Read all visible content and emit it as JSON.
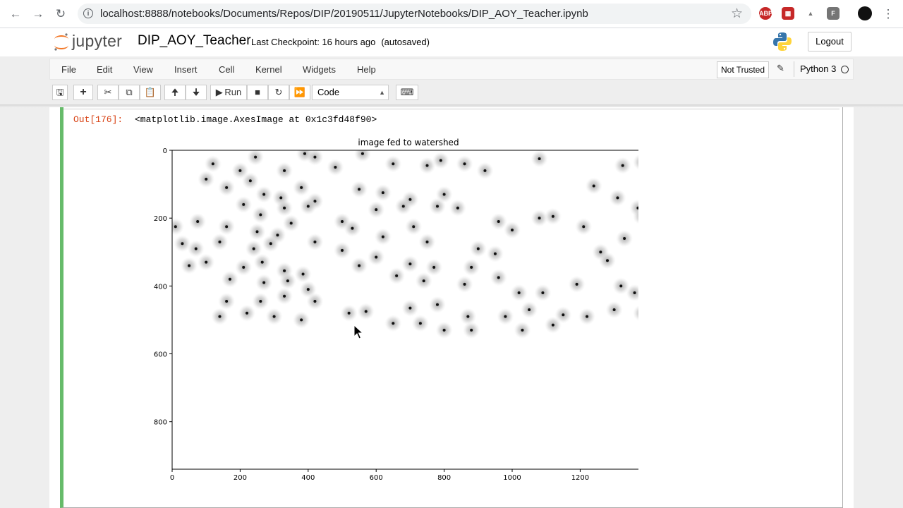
{
  "browser": {
    "url": "localhost:8888/notebooks/Documents/Repos/DIP/20190511/JupyterNotebooks/DIP_AOY_Teacher.ipynb",
    "extensions": [
      "ABP",
      "F"
    ]
  },
  "header": {
    "logo_text": "jupyter",
    "notebook_name": "DIP_AOY_Teacher",
    "checkpoint": "Last Checkpoint: 16 hours ago",
    "autosave": "(autosaved)",
    "logout_label": "Logout"
  },
  "menu": {
    "items": [
      "File",
      "Edit",
      "View",
      "Insert",
      "Cell",
      "Kernel",
      "Widgets",
      "Help"
    ],
    "trust": "Not Trusted",
    "kernel": "Python 3"
  },
  "toolbar": {
    "run_label": "Run",
    "cell_type": "Code"
  },
  "output": {
    "prompt": "Out[176]:",
    "text": "<matplotlib.image.AxesImage at 0x1c3fd48f90>"
  },
  "colors": {
    "cell_border_active": "#66bb6a",
    "out_prompt": "#d84315"
  },
  "chart_data": {
    "type": "heatmap",
    "title": "image fed to watershed",
    "xticks": [
      0,
      200,
      400,
      600,
      800,
      1000,
      1200
    ],
    "yticks": [
      0,
      200,
      400,
      600,
      800
    ],
    "xlim": [
      0,
      1390
    ],
    "ylim": [
      940,
      0
    ],
    "colormap": "gray",
    "blobs": [
      [
        120,
        40
      ],
      [
        200,
        60
      ],
      [
        245,
        20
      ],
      [
        330,
        60
      ],
      [
        390,
        10
      ],
      [
        420,
        20
      ],
      [
        480,
        50
      ],
      [
        560,
        10
      ],
      [
        650,
        40
      ],
      [
        750,
        45
      ],
      [
        790,
        30
      ],
      [
        860,
        40
      ],
      [
        920,
        60
      ],
      [
        1080,
        25
      ],
      [
        1325,
        45
      ],
      [
        1380,
        35
      ],
      [
        100,
        85
      ],
      [
        160,
        110
      ],
      [
        230,
        90
      ],
      [
        270,
        130
      ],
      [
        320,
        140
      ],
      [
        380,
        110
      ],
      [
        420,
        150
      ],
      [
        550,
        115
      ],
      [
        620,
        125
      ],
      [
        700,
        145
      ],
      [
        800,
        130
      ],
      [
        1240,
        105
      ],
      [
        1310,
        140
      ],
      [
        1370,
        170
      ],
      [
        210,
        160
      ],
      [
        260,
        190
      ],
      [
        330,
        170
      ],
      [
        400,
        165
      ],
      [
        600,
        175
      ],
      [
        680,
        165
      ],
      [
        780,
        165
      ],
      [
        840,
        170
      ],
      [
        10,
        225
      ],
      [
        75,
        210
      ],
      [
        160,
        225
      ],
      [
        250,
        240
      ],
      [
        310,
        250
      ],
      [
        350,
        215
      ],
      [
        500,
        210
      ],
      [
        530,
        230
      ],
      [
        620,
        255
      ],
      [
        710,
        225
      ],
      [
        750,
        270
      ],
      [
        960,
        210
      ],
      [
        1000,
        235
      ],
      [
        1080,
        200
      ],
      [
        1120,
        195
      ],
      [
        1210,
        225
      ],
      [
        1330,
        260
      ],
      [
        1380,
        195
      ],
      [
        30,
        275
      ],
      [
        70,
        290
      ],
      [
        140,
        270
      ],
      [
        240,
        290
      ],
      [
        290,
        275
      ],
      [
        420,
        270
      ],
      [
        500,
        295
      ],
      [
        600,
        315
      ],
      [
        900,
        290
      ],
      [
        950,
        305
      ],
      [
        1260,
        300
      ],
      [
        1280,
        325
      ],
      [
        50,
        340
      ],
      [
        100,
        330
      ],
      [
        210,
        345
      ],
      [
        265,
        330
      ],
      [
        330,
        355
      ],
      [
        385,
        365
      ],
      [
        550,
        340
      ],
      [
        700,
        335
      ],
      [
        770,
        345
      ],
      [
        880,
        345
      ],
      [
        170,
        380
      ],
      [
        270,
        390
      ],
      [
        340,
        385
      ],
      [
        400,
        410
      ],
      [
        660,
        370
      ],
      [
        740,
        385
      ],
      [
        860,
        395
      ],
      [
        960,
        375
      ],
      [
        1020,
        420
      ],
      [
        1090,
        420
      ],
      [
        1190,
        395
      ],
      [
        1320,
        400
      ],
      [
        1360,
        420
      ],
      [
        160,
        445
      ],
      [
        260,
        445
      ],
      [
        330,
        430
      ],
      [
        420,
        445
      ],
      [
        520,
        480
      ],
      [
        570,
        475
      ],
      [
        700,
        465
      ],
      [
        780,
        455
      ],
      [
        870,
        490
      ],
      [
        980,
        490
      ],
      [
        1050,
        470
      ],
      [
        1150,
        485
      ],
      [
        1220,
        490
      ],
      [
        1300,
        470
      ],
      [
        140,
        490
      ],
      [
        220,
        480
      ],
      [
        300,
        490
      ],
      [
        380,
        500
      ],
      [
        650,
        510
      ],
      [
        730,
        510
      ],
      [
        800,
        530
      ],
      [
        880,
        530
      ],
      [
        1030,
        530
      ],
      [
        1120,
        515
      ],
      [
        1380,
        480
      ]
    ]
  }
}
